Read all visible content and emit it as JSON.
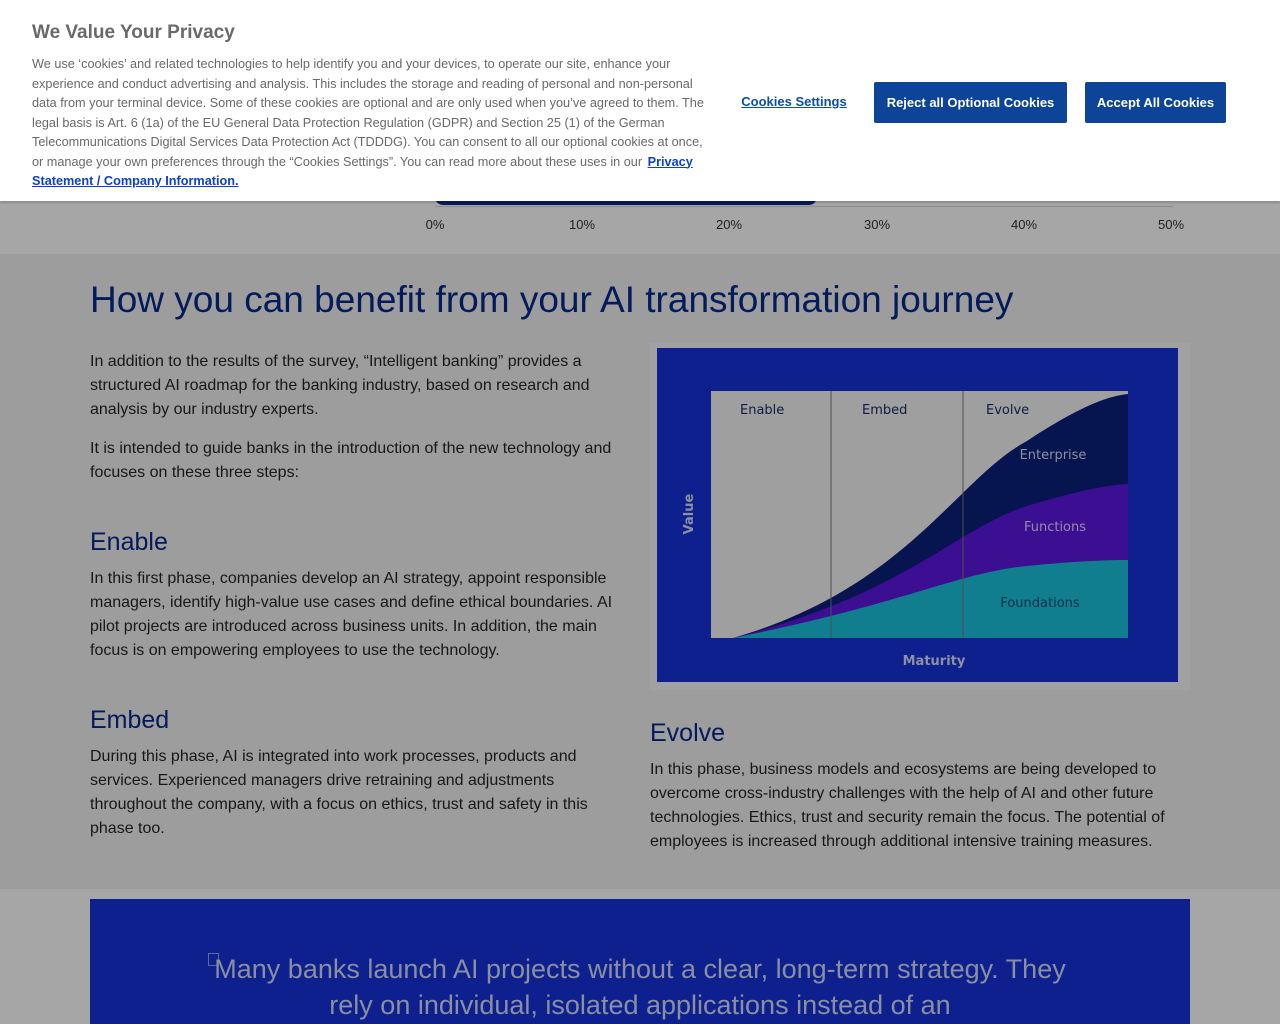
{
  "chart_fragment": {
    "ticks": [
      "0%",
      "10%",
      "20%",
      "30%",
      "40%",
      "50%"
    ]
  },
  "main": {
    "heading": "How you can benefit from your AI transformation journey",
    "intro_1": "In addition to the results of the survey, “Intelligent banking” provides a structured AI roadmap for the banking industry, based on research and analysis by our industry experts.",
    "intro_2": "It is intended to guide banks in the introduction of the new technology and focuses on these three steps:",
    "enable": {
      "heading": "Enable",
      "text": "In this first phase, companies develop an AI strategy, appoint responsible managers, identify high-value use cases and define ethical boundaries. AI pilot projects are introduced across business units. In addition, the main focus is on empowering employees to use the technology."
    },
    "embed": {
      "heading": "Embed",
      "text": "During this phase, AI is integrated into work processes, products and services. Experienced managers drive retraining and adjustments throughout the company, with a focus on ethics, trust and safety in this phase too."
    },
    "evolve": {
      "heading": "Evolve",
      "text": "In this phase, business models and ecosystems are being developed to overcome cross-industry challenges with the help of AI and other future technologies. Ethics, trust and security remain the focus. The potential of employees is increased through additional intensive training measures."
    }
  },
  "figure": {
    "phases": [
      "Enable",
      "Embed",
      "Evolve"
    ],
    "layers": [
      "Enterprise",
      "Functions",
      "Foundations"
    ],
    "y_label": "Value",
    "x_label": "Maturity",
    "colors": {
      "frame": "#1432d9",
      "enterprise": "#0a1f7a",
      "functions": "#5c16e0",
      "foundations": "#1bc2dd"
    }
  },
  "quote": {
    "icon": "quote-icon",
    "text": "Many banks launch AI projects without a clear, long-term strategy. They rely on individual, isolated applications instead of an"
  },
  "cookie": {
    "title": "We Value Your Privacy",
    "description": "We use ‘cookies’ and related technologies to help identify you and your devices, to operate our site, enhance your experience and conduct advertising and analysis. This includes the storage and reading of personal and non-personal data from your terminal device. Some of these cookies are optional and are only used when you’ve agreed to them. The legal basis is Art. 6 (1a) of the EU General Data Protection Regulation (GDPR) and Section 25 (1) of the German Telecommunications Digital Services Data Protection Act (TDDDG). You can consent to all our optional cookies at once, or manage your own preferences through the “Cookies Settings”. You can read more about these uses in our",
    "link": "Privacy Statement / Company Information.",
    "settings_label": "Cookies Settings",
    "reject_label": "Reject all Optional Cookies",
    "accept_label": "Accept All Cookies",
    "button_color": "#0e4498"
  }
}
